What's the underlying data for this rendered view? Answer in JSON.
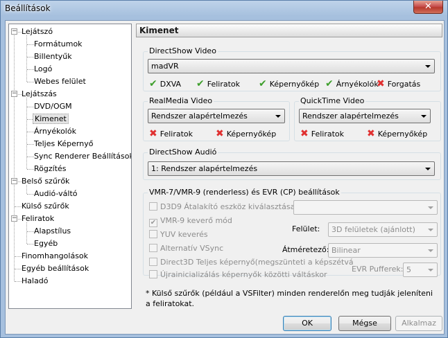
{
  "window": {
    "title": "Beállítások",
    "close_glyph": "✕"
  },
  "tree": {
    "items": [
      {
        "label": "Lejátszó",
        "level": 0,
        "expander": "−"
      },
      {
        "label": "Formátumok",
        "level": 1
      },
      {
        "label": "Billentyűk",
        "level": 1
      },
      {
        "label": "Logó",
        "level": 1
      },
      {
        "label": "Webes felület",
        "level": 1
      },
      {
        "label": "Lejátszás",
        "level": 0,
        "expander": "−"
      },
      {
        "label": "DVD/OGM",
        "level": 1
      },
      {
        "label": "Kimenet",
        "level": 1,
        "selected": true
      },
      {
        "label": "Árnyékolók",
        "level": 1
      },
      {
        "label": "Teljes Képernyő",
        "level": 1
      },
      {
        "label": "Sync Renderer Beállítások",
        "level": 1
      },
      {
        "label": "Rögzítés",
        "level": 1
      },
      {
        "label": "Belső szűrők",
        "level": 0,
        "expander": "−"
      },
      {
        "label": "Audió-váltó",
        "level": 1
      },
      {
        "label": "Külső szűrők",
        "level": 0
      },
      {
        "label": "Feliratok",
        "level": 0,
        "expander": "−"
      },
      {
        "label": "Alapstílus",
        "level": 1
      },
      {
        "label": "Egyéb",
        "level": 1
      },
      {
        "label": "Finomhangolások",
        "level": 0
      },
      {
        "label": "Egyéb beállítások",
        "level": 0
      },
      {
        "label": "Haladó",
        "level": 0
      }
    ]
  },
  "panel": {
    "title": "Kimenet",
    "directshow_video": {
      "title": "DirectShow Video",
      "selected": "madVR",
      "features": [
        {
          "label": "DXVA",
          "ok": true
        },
        {
          "label": "Feliratok",
          "ok": true
        },
        {
          "label": "Képernyőkép",
          "ok": true
        },
        {
          "label": "Árnyékolók",
          "ok": true
        },
        {
          "label": "Forgatás",
          "ok": false
        }
      ]
    },
    "realmedia_video": {
      "title": "RealMedia Video",
      "selected": "Rendszer alapértelmezés",
      "features": [
        {
          "label": "Feliratok",
          "ok": false
        },
        {
          "label": "Képernyőkép",
          "ok": false
        }
      ]
    },
    "quicktime_video": {
      "title": "QuickTime Video",
      "selected": "Rendszer alapértelmezés",
      "features": [
        {
          "label": "Feliratok",
          "ok": false
        },
        {
          "label": "Képernyőkép",
          "ok": false
        }
      ]
    },
    "directshow_audio": {
      "title": "DirectShow Audió",
      "selected": "1: Rendszer alapértelmezés"
    },
    "vmr": {
      "title": "VMR-7/VMR-9 (renderless) és EVR (CP) beállítások",
      "d3d9_label": "D3D9 Átalakító eszköz kiválasztása",
      "d3d9_value": "",
      "vmr9_mixer_label": "VMR-9 keverő mód",
      "vmr9_mixer_checked": true,
      "yuv_label": "YUV keverés",
      "alt_vsync_label": "Alternatív VSync",
      "d3d_fullscreen_label": "Direct3D Teljes képernyő(megszünteti a képszétvá",
      "reinit_label": "Újrainicializálás képernyők közötti váltáskor",
      "surface_label": "Felület:",
      "surface_value": "3D felületek (ajánlott)",
      "resizer_label": "Átméretező:",
      "resizer_value": "Bilinear",
      "evr_buffers_label": "EVR Pufferek:",
      "evr_buffers_value": "5"
    },
    "note": "* Külső szűrők (például a VSFilter) minden renderelőn meg tudják jeleníteni a feliratokat."
  },
  "buttons": {
    "ok": "OK",
    "cancel": "Mégse",
    "apply": "Alkalmaz"
  },
  "glyphs": {
    "check": "✔",
    "cross": "✖",
    "checkbox_checked": "✔"
  },
  "colors": {
    "check": "#3e9f2c",
    "cross": "#e03030"
  }
}
